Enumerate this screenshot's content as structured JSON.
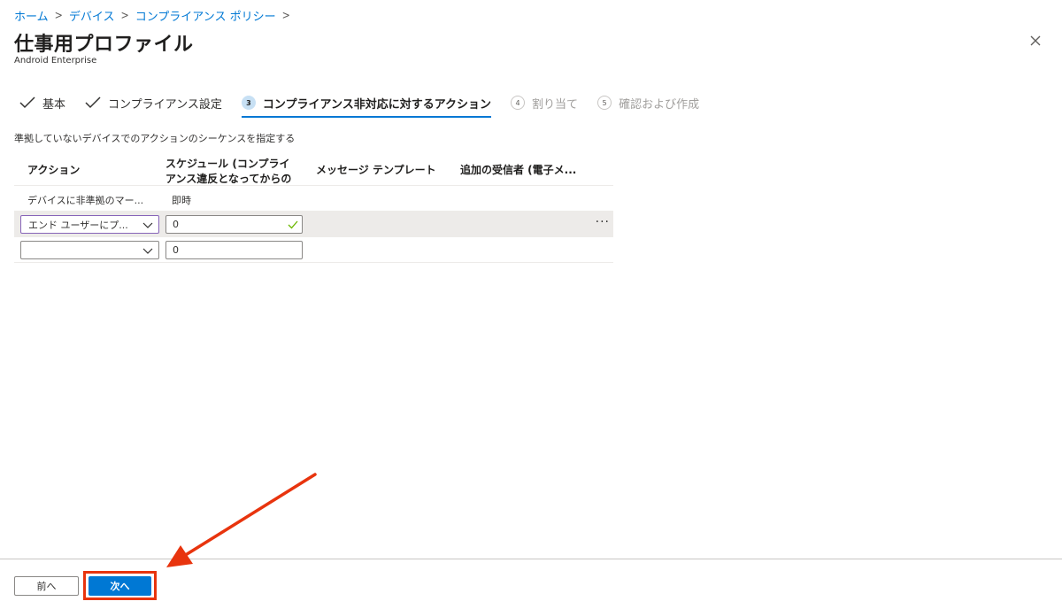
{
  "breadcrumb": [
    "ホーム",
    "デバイス",
    "コンプライアンス ポリシー"
  ],
  "title": "仕事用プロファイル",
  "subtitle": "Android Enterprise",
  "steps": [
    {
      "label": "基本",
      "state": "done"
    },
    {
      "label": "コンプライアンス設定",
      "state": "done"
    },
    {
      "label": "コンプライアンス非対応に対するアクション",
      "num": "3",
      "state": "active"
    },
    {
      "label": "割り当て",
      "num": "4",
      "state": "disabled"
    },
    {
      "label": "確認および作成",
      "num": "5",
      "state": "disabled"
    }
  ],
  "description": "準拠していないデバイスでのアクションのシーケンスを指定する",
  "table": {
    "headers": {
      "action": "アクション",
      "schedule_line1": "スケジュール (コンプライ",
      "schedule_line2": "アンス違反となってからの",
      "template": "メッセージ テンプレート",
      "recipients": "追加の受信者 (電子メ..."
    },
    "rows": [
      {
        "action": "デバイスに非準拠のマー...",
        "schedule": "即時"
      },
      {
        "action": "エンド ユーザーにプ...",
        "schedule": "0"
      },
      {
        "action": "",
        "schedule": "0"
      }
    ],
    "more": "···"
  },
  "footer": {
    "prev": "前へ",
    "next": "次へ"
  },
  "colors": {
    "link": "#0078d4",
    "primary": "#0078d4",
    "highlight": "#e8340e",
    "check": "#6bb700"
  }
}
